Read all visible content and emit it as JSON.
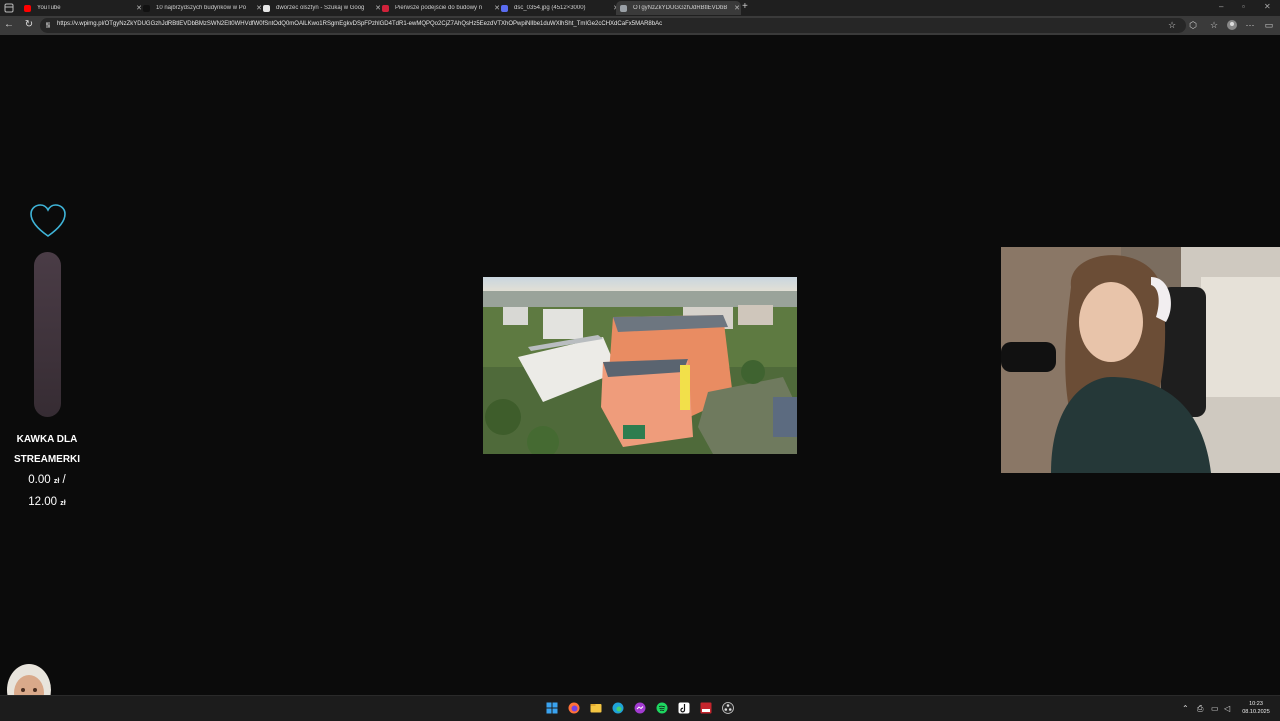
{
  "browser": {
    "tabs": [
      {
        "title": "YouTube",
        "favicon_color": "#ff0000",
        "active": false
      },
      {
        "title": "10 najbrzydszych budynków w Po",
        "favicon_color": "#111111",
        "active": false
      },
      {
        "title": "dworzec olsztyn - Szukaj w Goog",
        "favicon_color": "#e6e6e6",
        "active": false
      },
      {
        "title": "Pierwsze podejście do budowy n",
        "favicon_color": "#d0223a",
        "active": false
      },
      {
        "title": "dsc_0354.jpg (4512×3000)",
        "favicon_color": "#5a6cf0",
        "active": false
      },
      {
        "title": "OTgyNzZkYDUGGzhJdRBtlEVDbB",
        "favicon_color": "#9aa0a6",
        "active": true
      }
    ],
    "url": "https://v.wpimg.pl/OTgyNzZkYDUGGzhJdRBtlEVDbBMzSWN2Elt0WHVdfW0fSntOdQ0mOAlLKwo1RSgmEgkvDSpFPzhlGD4TdR1-ewMQPQo2CjZ7AhQsHz5EezdVTXhOPwpiNlIbe1duWXlhSht_TmIGe2cCHXdCaFx5MAR8bAc"
  },
  "stream": {
    "goal_title_line1": "KAWKA DLA",
    "goal_title_line2": "STREAMERKI",
    "goal_current": "0.00",
    "goal_target": "12.00",
    "goal_separator": "/",
    "currency": "zł",
    "goal_progress": 0.0,
    "accent_color": "#3fb4d8"
  },
  "taskbar": {
    "clock_time": "10:23",
    "clock_date": "08.10.2025"
  }
}
